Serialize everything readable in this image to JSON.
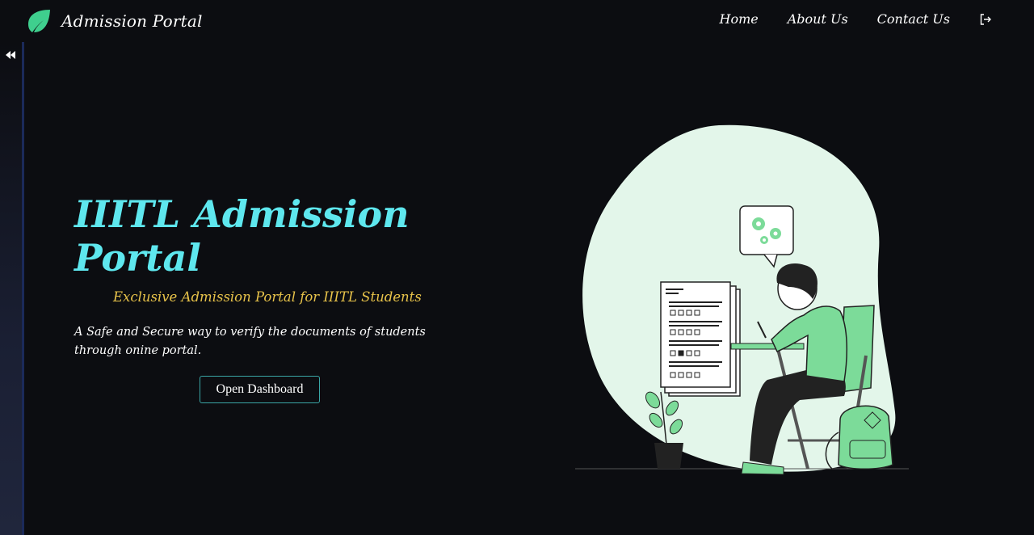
{
  "navbar": {
    "brand_title": "Admission Portal",
    "links": [
      {
        "label": "Home"
      },
      {
        "label": "About Us"
      },
      {
        "label": "Contact Us"
      }
    ],
    "logout_icon": "sign-out-icon"
  },
  "sidebar": {
    "toggle_icon": "double-chevron-left-icon"
  },
  "hero": {
    "title": "IIITL Admission Portal",
    "subtitle": "Exclusive Admission Portal for IIITL Students",
    "description": "A Safe and Secure way to verify the documents of students through onine portal.",
    "button_label": "Open Dashboard"
  },
  "colors": {
    "background": "#0c0d11",
    "accent_cyan": "#5ee7ee",
    "accent_gold": "#e8c34a",
    "brand_green": "#3fcf8e",
    "illustration_blob": "#e3f6ea",
    "illustration_green": "#7cdb99"
  }
}
